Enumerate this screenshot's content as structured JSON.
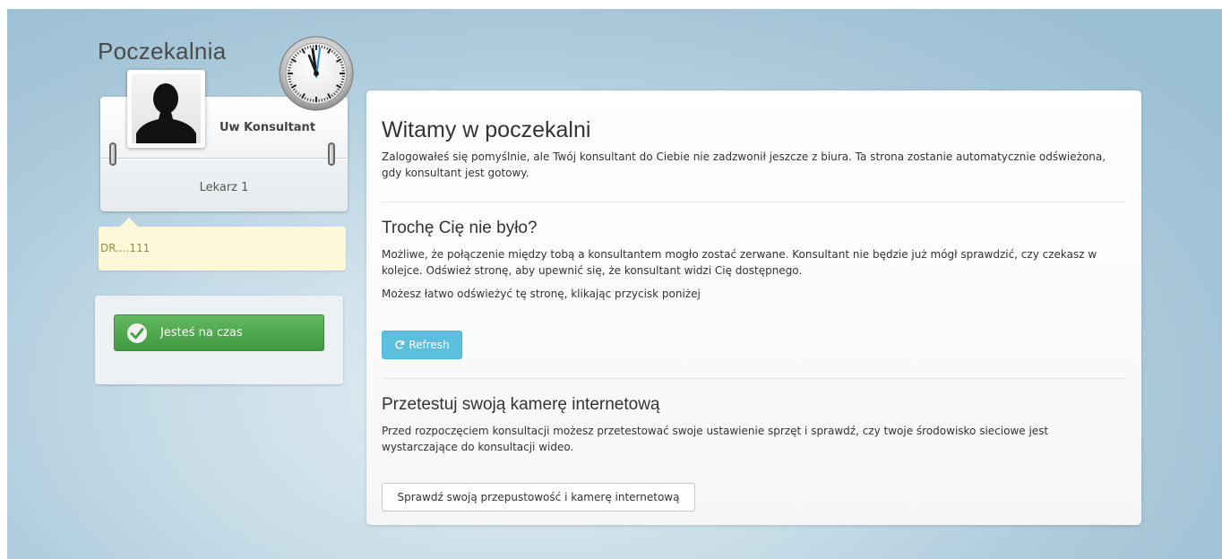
{
  "sidebar": {
    "title": "Poczekalnia",
    "consultant_name": "Uw Konsultant",
    "doctor_role": "Lekarz 1",
    "patient_code": "DR....111",
    "status_label": "Jesteś na czas"
  },
  "main": {
    "welcome_title": "Witamy w poczekalni",
    "welcome_text": "Zalogowałeś się pomyślnie, ale Twój konsultant do Ciebie nie zadzwonił jeszcze z biura. Ta strona zostanie automatycznie odświeżona, gdy konsultant jest gotowy.",
    "away_title": "Trochę Cię nie było?",
    "away_text": "Możliwe, że połączenie między tobą a konsultantem mogło zostać zerwane. Konsultant nie będzie już mógł sprawdzić, czy czekasz w kolejce. Odśwież stronę, aby upewnić się, że konsultant widzi Cię dostępnego.",
    "refresh_hint": "Możesz łatwo odświeżyć tę stronę, klikając przycisk poniżej",
    "refresh_label": "Refresh",
    "camera_title": "Przetestuj swoją kamerę internetową",
    "camera_text": "Przed rozpoczęciem konsultacji możesz przetestować swoje ustawienie sprzęt i sprawdź, czy twoje środowisko sieciowe jest wystarczające do konsultacji wideo.",
    "camera_button_label": "Sprawdź swoją przepustowość i kamerę internetową"
  },
  "colors": {
    "status_green": "#4cae4c",
    "refresh_blue": "#5bc0de",
    "note_yellow": "#fdf8d9"
  },
  "icons": [
    "clock-icon",
    "avatar-silhouette-icon",
    "check-icon",
    "refresh-icon"
  ]
}
